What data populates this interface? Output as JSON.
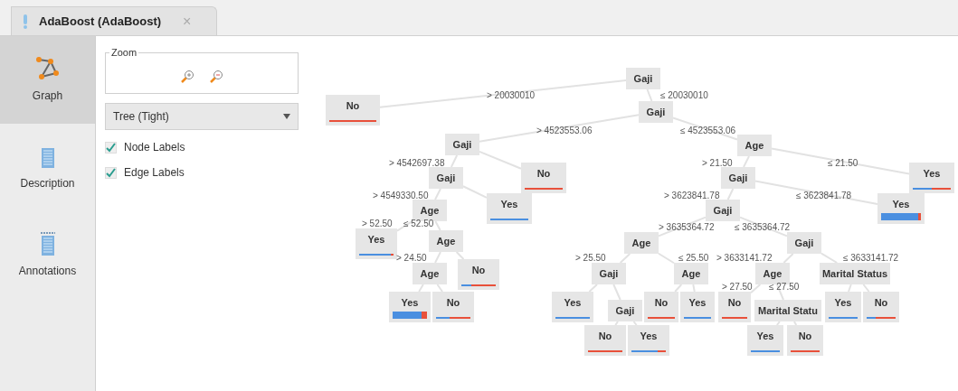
{
  "tab": {
    "title": "AdaBoost (AdaBoost)",
    "close": "×"
  },
  "nav": [
    {
      "label": "Graph",
      "selected": true
    },
    {
      "label": "Description",
      "selected": false
    },
    {
      "label": "Annotations",
      "selected": false
    }
  ],
  "zoom": {
    "legend": "Zoom"
  },
  "layout_select": {
    "value": "Tree (Tight)"
  },
  "options": [
    {
      "label": "Node Labels",
      "checked": true
    },
    {
      "label": "Edge Labels",
      "checked": true
    }
  ],
  "tree": {
    "name": "Gaji",
    "kind": "split",
    "children": [
      {
        "edge": "> 20030010",
        "name": "No",
        "kind": "leaf",
        "level": 0
      },
      {
        "edge": "≤ 20030010",
        "name": "Gaji",
        "kind": "split",
        "children": [
          {
            "edge": "> 4523553.06",
            "name": "Gaji",
            "kind": "split",
            "children": [
              {
                "edge": "> 4542697.38",
                "name": "Gaji",
                "kind": "split",
                "children": [
                  {
                    "edge": "> 4549330.50",
                    "name": "Age",
                    "kind": "split",
                    "children": [
                      {
                        "edge": "> 52.50",
                        "name": "Yes",
                        "kind": "leaf",
                        "level": 0.92
                      },
                      {
                        "edge": "≤ 52.50",
                        "name": "Age",
                        "kind": "split",
                        "children": [
                          {
                            "edge": "> 24.50",
                            "name": "Age",
                            "kind": "split",
                            "children": [
                              {
                                "name": "Yes",
                                "kind": "bigleaf",
                                "level": 0.85
                              },
                              {
                                "name": "No",
                                "kind": "leaf",
                                "level": 0.4
                              }
                            ]
                          },
                          {
                            "name": "No",
                            "kind": "leaf",
                            "level": 0.3
                          }
                        ]
                      }
                    ]
                  },
                  {
                    "name": "Yes",
                    "kind": "leaf",
                    "level": 1
                  }
                ]
              },
              {
                "name": "No",
                "kind": "leaf",
                "level": 0
              }
            ]
          },
          {
            "edge": "≤ 4523553.06",
            "name": "Age",
            "kind": "split",
            "children": [
              {
                "edge": "> 21.50",
                "name": "Gaji",
                "kind": "split",
                "children": [
                  {
                    "edge": "> 3623841.78",
                    "name": "Gaji",
                    "kind": "split",
                    "children": [
                      {
                        "edge": "> 3635364.72",
                        "name": "Age",
                        "kind": "split",
                        "children": [
                          {
                            "edge": "> 25.50",
                            "name": "Gaji",
                            "kind": "split",
                            "children": [
                              {
                                "name": "Yes",
                                "kind": "leaf",
                                "level": 1
                              },
                              {
                                "name": "Gaji",
                                "kind": "split",
                                "children": [
                                  {
                                    "name": "No",
                                    "kind": "leaf",
                                    "level": 0
                                  },
                                  {
                                    "name": "Yes",
                                    "kind": "leaf",
                                    "level": 0.75
                                  }
                                ]
                              }
                            ]
                          },
                          {
                            "edge": "≤ 25.50",
                            "name": "Age",
                            "kind": "split",
                            "children": [
                              {
                                "name": "No",
                                "kind": "leaf",
                                "level": 0
                              },
                              {
                                "name": "Yes",
                                "kind": "leaf",
                                "level": 1
                              }
                            ]
                          }
                        ]
                      },
                      {
                        "edge": "≤ 3635364.72",
                        "name": "Gaji",
                        "kind": "split",
                        "children": [
                          {
                            "edge": "> 3633141.72",
                            "name": "Age",
                            "kind": "split",
                            "children": [
                              {
                                "edge": "> 27.50",
                                "name": "No",
                                "kind": "leaf",
                                "level": 0
                              },
                              {
                                "edge": "≤ 27.50",
                                "name": "Marital Statu",
                                "kind": "split",
                                "children": [
                                  {
                                    "name": "Yes",
                                    "kind": "leaf",
                                    "level": 1
                                  },
                                  {
                                    "name": "No",
                                    "kind": "leaf",
                                    "level": 0
                                  }
                                ]
                              }
                            ]
                          },
                          {
                            "edge": "≤ 3633141.72",
                            "name": "Marital Status",
                            "kind": "split",
                            "children": [
                              {
                                "name": "Yes",
                                "kind": "leaf",
                                "level": 1
                              },
                              {
                                "name": "No",
                                "kind": "leaf",
                                "level": 0.3
                              }
                            ]
                          }
                        ]
                      }
                    ]
                  },
                  {
                    "edge": "≤ 3623841.78",
                    "name": "Yes",
                    "kind": "bigleaf",
                    "level": 0.93
                  }
                ]
              },
              {
                "edge": "≤ 21.50",
                "name": "Yes",
                "kind": "leaf",
                "level": 0.5
              }
            ]
          }
        ]
      }
    ]
  }
}
